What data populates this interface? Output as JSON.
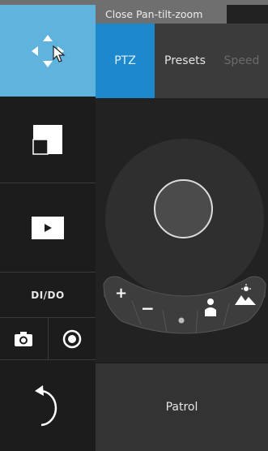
{
  "tooltip": "Close Pan-tilt-zoom",
  "tabs": [
    {
      "label": "PTZ",
      "active": true
    },
    {
      "label": "Presets",
      "active": false
    },
    {
      "label": "Speed",
      "active": false
    }
  ],
  "left_column": {
    "ptz_icon": "pan-arrows-icon",
    "aspect_icon": "aspect-ratio-icon",
    "play_icon": "play-icon",
    "dido_label": "DI/DO",
    "snapshot_icon": "camera-icon",
    "record_icon": "record-icon",
    "back_icon": "undo-arrow-icon"
  },
  "zoom_controls": {
    "zoom_in": "+",
    "zoom_out": "−",
    "positions": [
      "dot-icon",
      "person-icon",
      "landscape-icon"
    ]
  },
  "patrol_label": "Patrol",
  "colors": {
    "accent": "#1e88cc",
    "ptz_button": "#5fb3dd"
  }
}
